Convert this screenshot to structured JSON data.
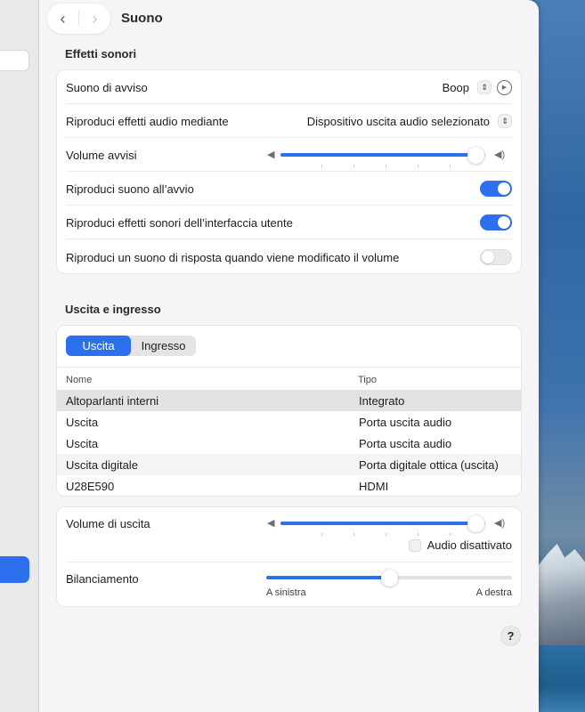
{
  "window": {
    "title": "Suono",
    "back_glyph": "‹",
    "forward_glyph": "›"
  },
  "sound_effects": {
    "section_title": "Effetti sonori",
    "alert_sound": {
      "label": "Suono di avviso",
      "value": "Boop"
    },
    "play_through": {
      "label": "Riproduci effetti audio mediante",
      "value": "Dispositivo uscita audio selezionato"
    },
    "alert_volume": {
      "label": "Volume avvisi",
      "level": 0.95
    },
    "startup_sound": {
      "label": "Riproduci suono all’avvio",
      "on": true
    },
    "ui_sounds": {
      "label": "Riproduci effetti sonori dell’interfaccia utente",
      "on": true
    },
    "volume_feedback": {
      "label": "Riproduci un suono di risposta quando viene modificato il volume",
      "on": false
    }
  },
  "output_input": {
    "section_title": "Uscita e ingresso",
    "tabs": [
      "Uscita",
      "Ingresso"
    ],
    "active_tab": "Uscita",
    "columns": [
      "Nome",
      "Tipo"
    ],
    "devices": [
      {
        "name": "Altoparlanti interni",
        "type": "Integrato",
        "selected": true
      },
      {
        "name": "Uscita",
        "type": "Porta uscita audio",
        "selected": false
      },
      {
        "name": "Uscita",
        "type": "Porta uscita audio",
        "selected": false
      },
      {
        "name": "Uscita digitale",
        "type": "Porta digitale ottica (uscita)",
        "selected": false
      },
      {
        "name": "U28E590",
        "type": "HDMI",
        "selected": false
      }
    ]
  },
  "output_volume": {
    "label": "Volume di uscita",
    "level": 0.95,
    "mute_label": "Audio disattivato",
    "muted": false
  },
  "balance": {
    "label": "Bilanciamento",
    "value": 0.5,
    "left_label": "A sinistra",
    "right_label": "A destra"
  },
  "help": {
    "label": "?"
  },
  "colors": {
    "accent": "#2e6ff0"
  },
  "icons": {
    "speaker_low": "speaker-low-icon",
    "speaker_high": "speaker-high-icon",
    "play": "play-icon",
    "stepper": "chevron-up-down-icon"
  }
}
